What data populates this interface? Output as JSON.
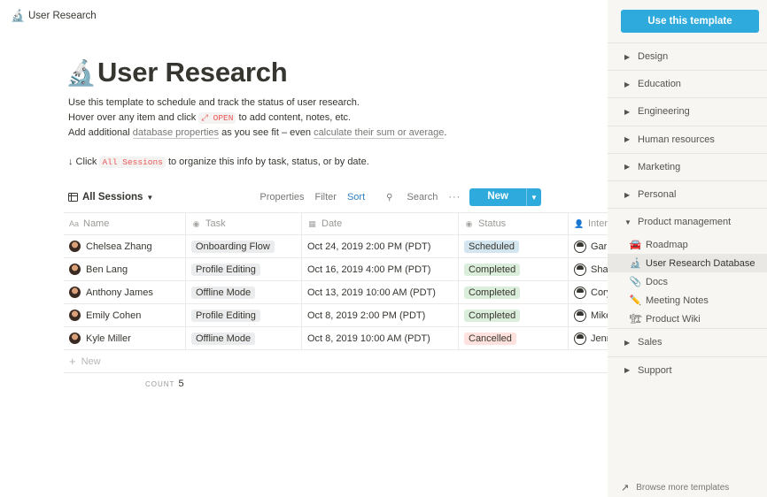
{
  "breadcrumb": {
    "icon": "🔬",
    "label": "User Research"
  },
  "page": {
    "icon": "🔬",
    "title": "User Research",
    "desc_line1": "Use this template to schedule and track the status of user research.",
    "desc_line2_a": "Hover over any item and click",
    "desc_line2_code": "⤢ OPEN",
    "desc_line2_b": "to add content, notes, etc.",
    "desc_line3_a": "Add additional",
    "desc_line3_link1": "database properties",
    "desc_line3_b": "as you see fit – even",
    "desc_line3_link2": "calculate their sum or average",
    "desc_line3_c": ".",
    "hint_a": "↓ Click",
    "hint_code": "All Sessions",
    "hint_b": "to organize this info by task, status, or by date."
  },
  "view": {
    "name": "All Sessions",
    "properties": "Properties",
    "filter": "Filter",
    "sort": "Sort",
    "search": "Search",
    "more": "···",
    "new": "New"
  },
  "table": {
    "columns": [
      {
        "label": "Name",
        "icon": "Aa"
      },
      {
        "label": "Task",
        "icon": "◉"
      },
      {
        "label": "Date",
        "icon": "▦"
      },
      {
        "label": "Status",
        "icon": "◉"
      },
      {
        "label": "Interviewer",
        "icon": "👤"
      }
    ],
    "rows": [
      {
        "name": "Chelsea Zhang",
        "task": "Onboarding Flow",
        "date": "Oct 24, 2019 2:00 PM (PDT)",
        "status": "Scheduled",
        "interviewer": "Garrett"
      },
      {
        "name": "Ben Lang",
        "task": "Profile Editing",
        "date": "Oct 16, 2019 4:00 PM (PDT)",
        "status": "Completed",
        "interviewer": "Shawn"
      },
      {
        "name": "Anthony James",
        "task": "Offline Mode",
        "date": "Oct 13, 2019 10:00 AM (PDT)",
        "status": "Completed",
        "interviewer": "Cory"
      },
      {
        "name": "Emily Cohen",
        "task": "Profile Editing",
        "date": "Oct 8, 2019 2:00 PM (PDT)",
        "status": "Completed",
        "interviewer": "Mike"
      },
      {
        "name": "Kyle Miller",
        "task": "Offline Mode",
        "date": "Oct 8, 2019 10:00 AM (PDT)",
        "status": "Cancelled",
        "interviewer": "Jenn"
      }
    ],
    "new_row": "New",
    "count_label": "COUNT",
    "count_value": "5"
  },
  "status_colors": {
    "Scheduled": "#d3e5ef",
    "Completed": "#dbeddb",
    "Cancelled": "#ffe2dd"
  },
  "sidebar": {
    "use_template": "Use this template",
    "categories": [
      {
        "label": "Design",
        "expanded": false
      },
      {
        "label": "Education",
        "expanded": false
      },
      {
        "label": "Engineering",
        "expanded": false
      },
      {
        "label": "Human resources",
        "expanded": false
      },
      {
        "label": "Marketing",
        "expanded": false
      },
      {
        "label": "Personal",
        "expanded": false
      },
      {
        "label": "Product management",
        "expanded": true
      },
      {
        "label": "Sales",
        "expanded": false
      },
      {
        "label": "Support",
        "expanded": false
      }
    ],
    "subitems": [
      {
        "icon": "🚘",
        "label": "Roadmap",
        "active": false
      },
      {
        "icon": "🔬",
        "label": "User Research Database",
        "active": true
      },
      {
        "icon": "📎",
        "label": "Docs",
        "active": false
      },
      {
        "icon": "✏️",
        "label": "Meeting Notes",
        "active": false
      },
      {
        "icon": "🏗",
        "label": "Product Wiki",
        "active": false
      }
    ],
    "browse": "Browse more templates"
  }
}
